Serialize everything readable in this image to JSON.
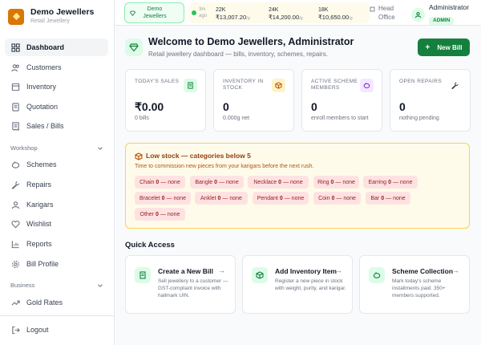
{
  "brand": {
    "name": "Demo Jewellers",
    "subtitle": "Retail Jewellery"
  },
  "sidebar": {
    "main_items": [
      {
        "label": "Dashboard",
        "icon": "dashboard-icon",
        "active": true
      },
      {
        "label": "Customers",
        "icon": "users-icon"
      },
      {
        "label": "Inventory",
        "icon": "box-icon"
      },
      {
        "label": "Quotation",
        "icon": "document-icon"
      },
      {
        "label": "Sales / Bills",
        "icon": "receipt-icon"
      }
    ],
    "workshop_label": "Workshop",
    "workshop_items": [
      {
        "label": "Schemes",
        "icon": "piggy-bank-icon"
      },
      {
        "label": "Repairs",
        "icon": "wrench-icon"
      },
      {
        "label": "Karigars",
        "icon": "user-group-icon"
      },
      {
        "label": "Wishlist",
        "icon": "heart-icon"
      },
      {
        "label": "Reports",
        "icon": "chart-icon"
      },
      {
        "label": "Bill Profile",
        "icon": "gear-icon"
      }
    ],
    "business_label": "Business",
    "business_items": [
      {
        "label": "Gold Rates",
        "icon": "trending-up-icon"
      }
    ],
    "logout_label": "Logout"
  },
  "topbar": {
    "store": "Demo Jewellers",
    "rates_age": "3m ago",
    "rates": [
      {
        "karat": "22K",
        "value": "₹13,007.20",
        "unit": "/g"
      },
      {
        "karat": "24K",
        "value": "₹14,200.00",
        "unit": "/g"
      },
      {
        "karat": "18K",
        "value": "₹10,650.00",
        "unit": "/g"
      }
    ],
    "branch": "Head Office",
    "user_name": "Administrator",
    "user_role": "ADMIN"
  },
  "welcome": {
    "title": "Welcome to Demo Jewellers, Administrator",
    "subtitle": "Retail jewellery dashboard — bills, inventory, schemes, repairs.",
    "new_bill_label": "New Bill"
  },
  "stats": [
    {
      "label": "TODAY'S SALES",
      "value": "₹0.00",
      "note": "0 bills",
      "icon": "receipt-icon",
      "color": "#dcfce7"
    },
    {
      "label": "INVENTORY IN STOCK",
      "value": "0",
      "note": "0.000g net",
      "icon": "box-icon",
      "color": "#fef3c7"
    },
    {
      "label": "ACTIVE SCHEME MEMBERS",
      "value": "0",
      "note": "enroll members to start",
      "icon": "piggy-bank-icon",
      "color": "#f3e8ff"
    },
    {
      "label": "OPEN REPAIRS",
      "value": "0",
      "note": "nothing pending",
      "icon": "wrench-icon",
      "color": "#ffffff"
    }
  ],
  "low_stock": {
    "title": "Low stock — categories below 5",
    "subtitle": "Time to commission new pieces from your karigars before the next rush.",
    "chips": [
      {
        "name": "Chain",
        "count": "0",
        "status": "— none"
      },
      {
        "name": "Bangle",
        "count": "0",
        "status": "— none"
      },
      {
        "name": "Necklace",
        "count": "0",
        "status": "— none"
      },
      {
        "name": "Ring",
        "count": "0",
        "status": "— none"
      },
      {
        "name": "Earring",
        "count": "0",
        "status": "— none"
      },
      {
        "name": "Bracelet",
        "count": "0",
        "status": "— none"
      },
      {
        "name": "Anklet",
        "count": "0",
        "status": "— none"
      },
      {
        "name": "Pendant",
        "count": "0",
        "status": "— none"
      },
      {
        "name": "Coin",
        "count": "0",
        "status": "— none"
      },
      {
        "name": "Bar",
        "count": "0",
        "status": "— none"
      },
      {
        "name": "Other",
        "count": "0",
        "status": "— none"
      }
    ]
  },
  "quick_access": {
    "title": "Quick Access",
    "cards": [
      {
        "name": "Create a New Bill",
        "desc": "Sell jewellery to a customer — GST-compliant invoice with hallmark UIN.",
        "icon": "receipt-icon"
      },
      {
        "name": "Add Inventory Item",
        "desc": "Register a new piece in stock with weight, purity, and karigar.",
        "icon": "box-icon"
      },
      {
        "name": "Scheme Collection",
        "desc": "Mark today's scheme installments paid. 350+ members supported.",
        "icon": "piggy-bank-icon"
      }
    ],
    "arrow": "→"
  },
  "colors": {
    "accent": "#15803d",
    "warning_bg": "#fffbeb",
    "chip_bg": "#fee2e2"
  }
}
